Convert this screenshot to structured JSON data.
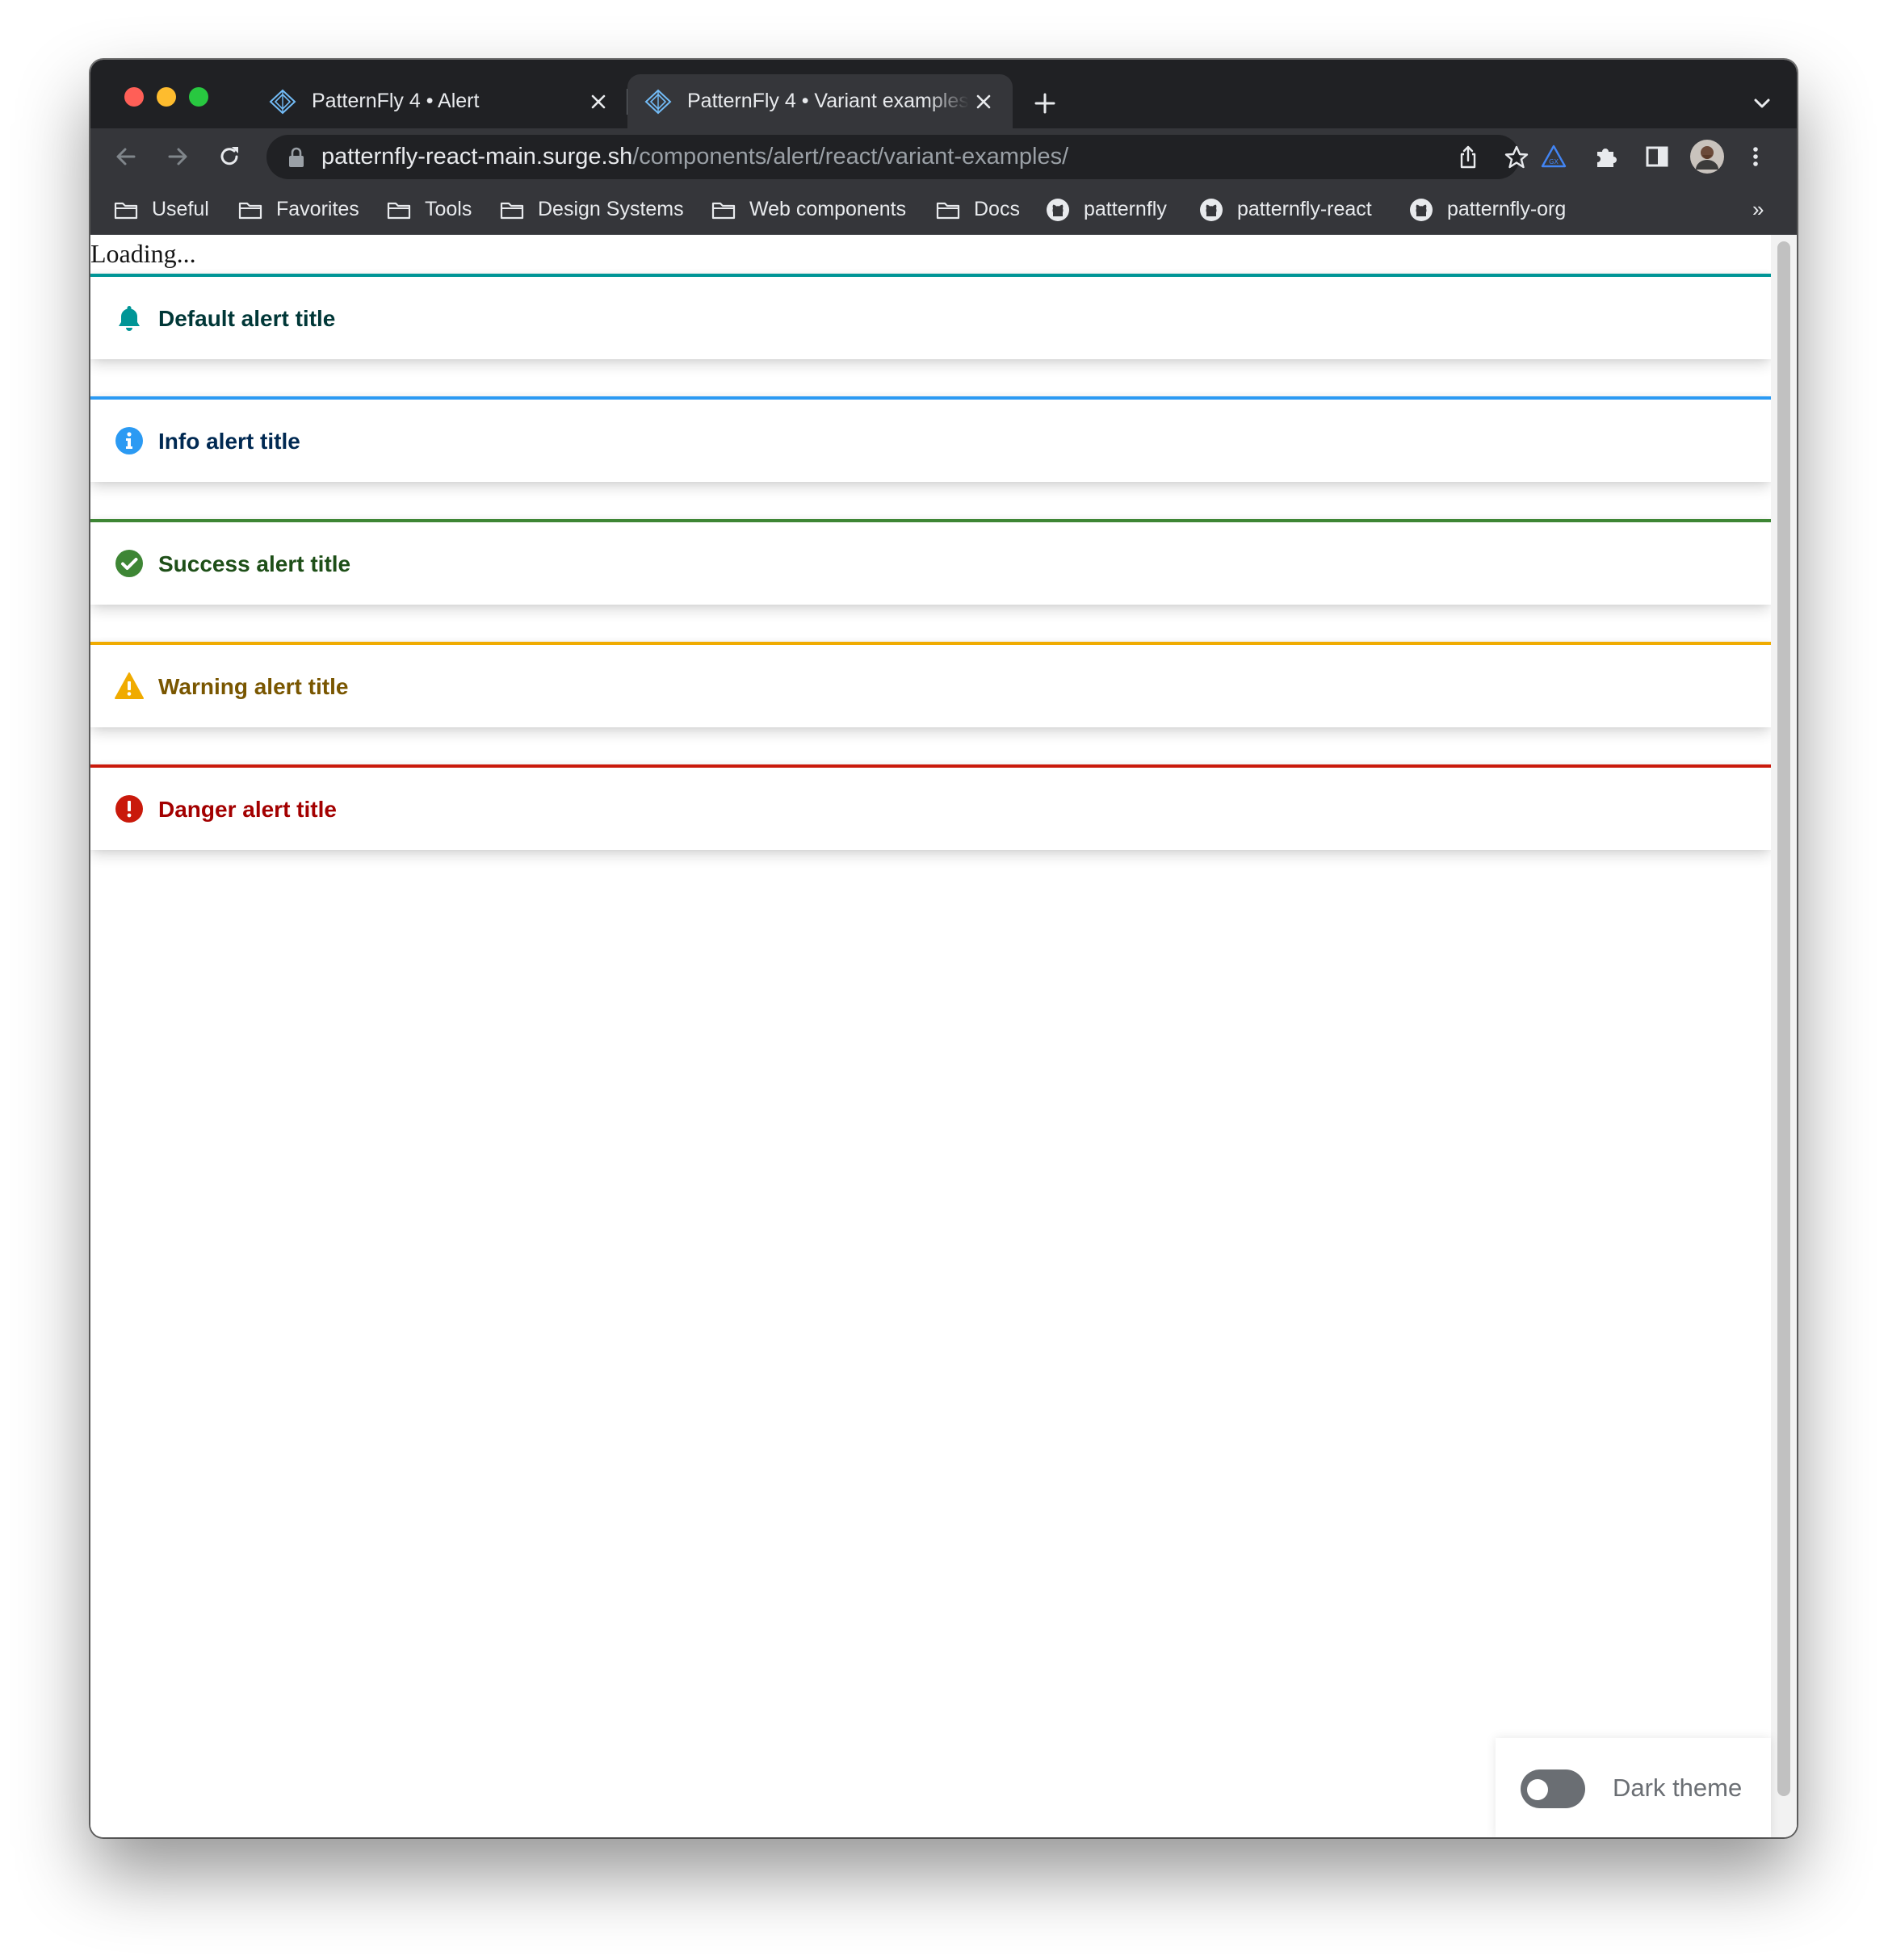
{
  "browser": {
    "tabs": [
      {
        "title": "PatternFly 4 • Alert",
        "favicon": "patternfly-logo-icon",
        "active": false
      },
      {
        "title": "PatternFly 4 • Variant examples",
        "favicon": "patternfly-logo-icon",
        "active": true
      }
    ],
    "url": {
      "host": "patternfly-react-main.surge.sh",
      "path": "/components/alert/react/variant-examples/"
    },
    "toolbar_icons": [
      "back-arrow-icon",
      "forward-arrow-icon",
      "reload-icon",
      "lock-icon",
      "share-icon",
      "bookmark-star-icon",
      "extension-triangle-icon",
      "puzzle-extensions-icon",
      "side-panel-icon",
      "profile-avatar",
      "kebab-menu-icon"
    ],
    "bookmarks": [
      {
        "label": "Useful",
        "icon": "folder-icon"
      },
      {
        "label": "Favorites",
        "icon": "folder-icon"
      },
      {
        "label": "Tools",
        "icon": "folder-icon"
      },
      {
        "label": "Design Systems",
        "icon": "folder-icon"
      },
      {
        "label": "Web components",
        "icon": "folder-icon"
      },
      {
        "label": "Docs",
        "icon": "folder-icon"
      },
      {
        "label": "patternfly",
        "icon": "github-icon"
      },
      {
        "label": "patternfly-react",
        "icon": "github-icon"
      },
      {
        "label": "patternfly-org",
        "icon": "github-icon"
      }
    ],
    "bookmarks_overflow": "»"
  },
  "page": {
    "loading_text": "Loading...",
    "alerts": [
      {
        "variant": "default",
        "title": "Default alert title",
        "icon": "bell-icon",
        "accent": "#009596",
        "icon_color": "#009596",
        "title_color": "#003737"
      },
      {
        "variant": "info",
        "title": "Info alert title",
        "icon": "info-circle-icon",
        "accent": "#2b9af3",
        "icon_color": "#2b9af3",
        "title_color": "#002952"
      },
      {
        "variant": "success",
        "title": "Success alert title",
        "icon": "check-circle-icon",
        "accent": "#3e8635",
        "icon_color": "#3e8635",
        "title_color": "#1e4f18"
      },
      {
        "variant": "warning",
        "title": "Warning alert title",
        "icon": "exclamation-triangle-icon",
        "accent": "#f0ab00",
        "icon_color": "#f0ab00",
        "title_color": "#795600"
      },
      {
        "variant": "danger",
        "title": "Danger alert title",
        "icon": "exclamation-circle-icon",
        "accent": "#c9190b",
        "icon_color": "#c9190b",
        "title_color": "#a30000"
      }
    ],
    "theme_toggle": {
      "label": "Dark theme",
      "on": false
    }
  }
}
